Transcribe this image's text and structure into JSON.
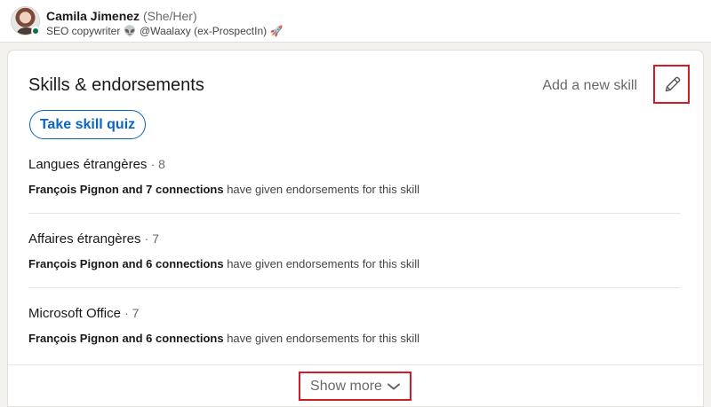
{
  "profile": {
    "name": "Camila Jimenez",
    "pronouns": "(She/Her)",
    "headline_part1": "SEO copywriter",
    "headline_emoji1": "👽",
    "headline_part2": "@Waalaxy (ex-ProspectIn)",
    "headline_emoji2": "🚀",
    "presence_color": "#057642"
  },
  "card": {
    "title": "Skills & endorsements",
    "add_skill_label": "Add a new skill",
    "edit_icon": "pencil-icon",
    "quiz_button_label": "Take skill quiz",
    "accent_color": "#0a66c2",
    "highlight_color": "#d11a2a"
  },
  "skills": [
    {
      "name": "Langues étrangères",
      "count": "· 8",
      "endorsers": "François Pignon and 7 connections",
      "endorse_text": " have given endorsements for this skill"
    },
    {
      "name": "Affaires étrangères",
      "count": "· 7",
      "endorsers": "François Pignon and 6 connections",
      "endorse_text": " have given endorsements for this skill"
    },
    {
      "name": "Microsoft Office",
      "count": "· 7",
      "endorsers": "François Pignon and 6 connections",
      "endorse_text": " have given endorsements for this skill"
    }
  ],
  "footer": {
    "show_more_label": "Show more",
    "chevron_icon": "chevron-down-icon"
  }
}
